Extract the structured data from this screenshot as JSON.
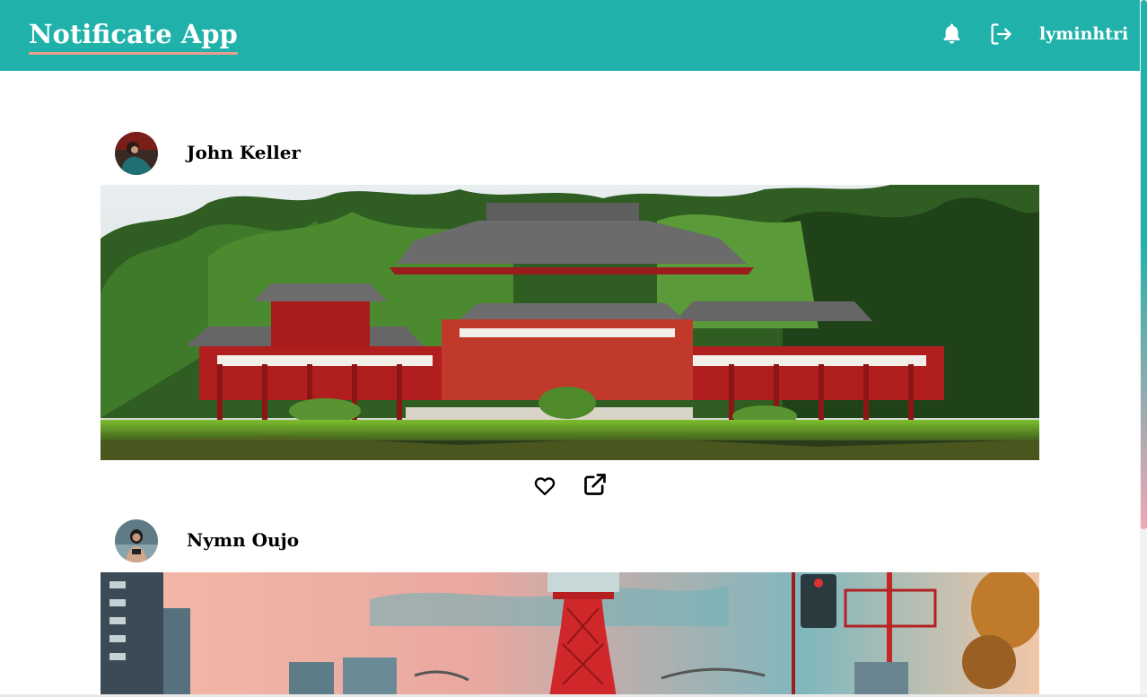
{
  "app": {
    "title": "Notificate App",
    "username": "lyminhtri"
  },
  "icons": {
    "notifications": "bell-icon",
    "logout": "sign-out-icon",
    "like": "heart-outline-icon",
    "share": "external-link-icon"
  },
  "colors": {
    "navbar": "#20b2aa",
    "brand_underline": "#e8a08a",
    "text": "#000000"
  },
  "posts": [
    {
      "author": "John Keller",
      "image": "Japanese temple with red pillars and tiled roofs surrounded by trees"
    },
    {
      "author": "Nymn Oujo",
      "image": "Red lattice tower and city buildings under a pink sky"
    }
  ]
}
